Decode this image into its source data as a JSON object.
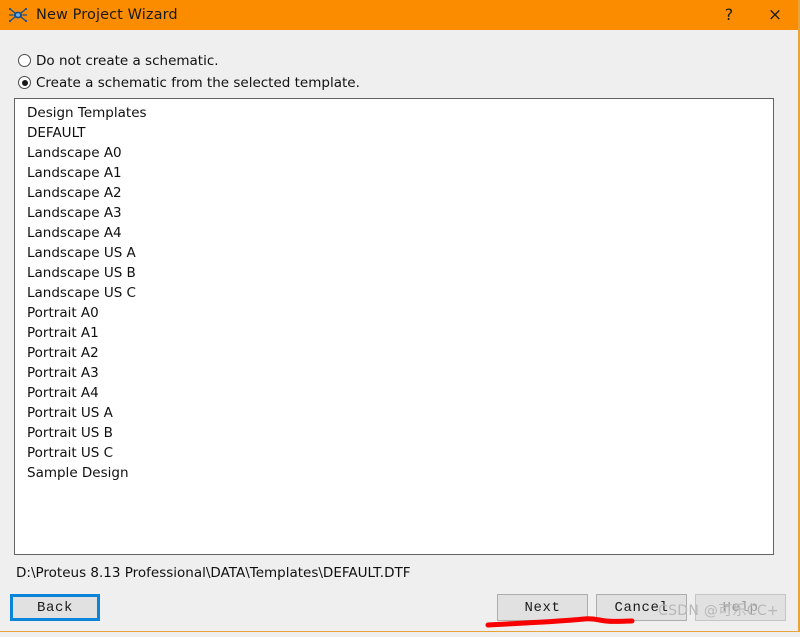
{
  "window": {
    "title": "New Project Wizard",
    "icon": "proteus-app-icon",
    "titlebar_color": "#fb8c00",
    "help_glyph": "?",
    "close_glyph": "×"
  },
  "options": {
    "items": [
      {
        "label": "Do not create a schematic.",
        "selected": false
      },
      {
        "label": "Create a schematic from the selected template.",
        "selected": true
      }
    ]
  },
  "template_list": {
    "items": [
      "Design Templates",
      "DEFAULT",
      "Landscape A0",
      "Landscape A1",
      "Landscape A2",
      "Landscape A3",
      "Landscape A4",
      "Landscape US A",
      "Landscape US B",
      "Landscape US C",
      "Portrait A0",
      "Portrait A1",
      "Portrait A2",
      "Portrait A3",
      "Portrait A4",
      "Portrait US A",
      "Portrait US B",
      "Portrait US C",
      "Sample Design"
    ]
  },
  "status": {
    "path": "D:\\Proteus 8.13 Professional\\DATA\\Templates\\DEFAULT.DTF"
  },
  "buttons": {
    "back": "Back",
    "next": "Next",
    "cancel": "Cancel",
    "help": "Help"
  },
  "watermark": {
    "text": "CSDN @可乐CC+"
  },
  "annotation": {
    "color": "#f80000",
    "type": "hand-drawn-underline"
  }
}
